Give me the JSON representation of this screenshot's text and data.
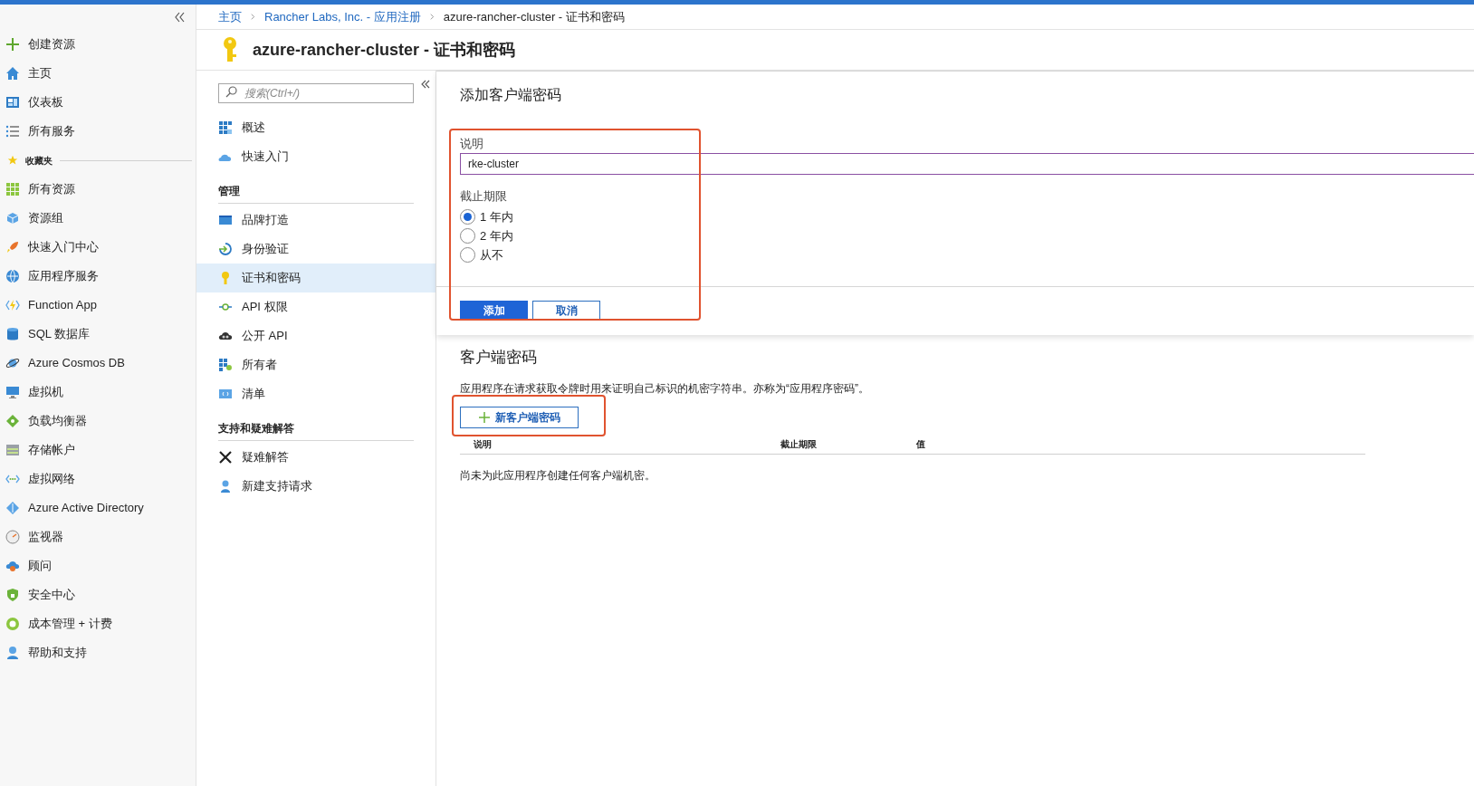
{
  "sidebar": {
    "items": [
      {
        "kind": "item",
        "label": "创建资源"
      },
      {
        "kind": "item",
        "label": "主页"
      },
      {
        "kind": "item",
        "label": "仪表板"
      },
      {
        "kind": "item",
        "label": "所有服务"
      },
      {
        "kind": "header",
        "label": "收藏夹"
      },
      {
        "kind": "item",
        "label": "所有资源"
      },
      {
        "kind": "item",
        "label": "资源组"
      },
      {
        "kind": "item",
        "label": "快速入门中心"
      },
      {
        "kind": "item",
        "label": "应用程序服务"
      },
      {
        "kind": "item",
        "label": "Function App"
      },
      {
        "kind": "item",
        "label": "SQL 数据库"
      },
      {
        "kind": "item",
        "label": "Azure Cosmos DB"
      },
      {
        "kind": "item",
        "label": "虚拟机"
      },
      {
        "kind": "item",
        "label": "负载均衡器"
      },
      {
        "kind": "item",
        "label": "存储帐户"
      },
      {
        "kind": "item",
        "label": "虚拟网络"
      },
      {
        "kind": "item",
        "label": "Azure Active Directory"
      },
      {
        "kind": "item",
        "label": "监视器"
      },
      {
        "kind": "item",
        "label": "顾问"
      },
      {
        "kind": "item",
        "label": "安全中心"
      },
      {
        "kind": "item",
        "label": "成本管理 + 计费"
      },
      {
        "kind": "item",
        "label": "帮助和支持"
      }
    ]
  },
  "breadcrumb": [
    {
      "label": "主页",
      "link": true
    },
    {
      "label": "Rancher Labs, Inc. - 应用注册",
      "link": true
    },
    {
      "label": "azure-rancher-cluster - 证书和密码",
      "link": false
    }
  ],
  "page_title": "azure-rancher-cluster - 证书和密码",
  "resource_menu": {
    "search": {
      "placeholder": "搜索(Ctrl+/)"
    },
    "items": [
      {
        "kind": "item",
        "label": "概述",
        "selected": false
      },
      {
        "kind": "item",
        "label": "快速入门",
        "selected": false
      },
      {
        "kind": "section",
        "label": "管理"
      },
      {
        "kind": "item",
        "label": "品牌打造",
        "selected": false
      },
      {
        "kind": "item",
        "label": "身份验证",
        "selected": false
      },
      {
        "kind": "item",
        "label": "证书和密码",
        "selected": true
      },
      {
        "kind": "item",
        "label": "API 权限",
        "selected": false
      },
      {
        "kind": "item",
        "label": "公开 API",
        "selected": false
      },
      {
        "kind": "item",
        "label": "所有者",
        "selected": false
      },
      {
        "kind": "item",
        "label": "清单",
        "selected": false
      },
      {
        "kind": "section",
        "label": "支持和疑难解答"
      },
      {
        "kind": "item",
        "label": "疑难解答",
        "selected": false
      },
      {
        "kind": "item",
        "label": "新建支持请求",
        "selected": false
      }
    ]
  },
  "add_secret_panel": {
    "title": "添加客户端密码",
    "description_label": "说明",
    "description_value": "rke-cluster",
    "expires_label": "截止期限",
    "expires_options": [
      {
        "label": "1 年内",
        "selected": true
      },
      {
        "label": "2 年内",
        "selected": false
      },
      {
        "label": "从不",
        "selected": false
      }
    ],
    "buttons": [
      "添加",
      "取消"
    ]
  },
  "client_secrets": {
    "title": "客户端密码",
    "description": "应用程序在请求获取令牌时用来证明自己标识的机密字符串。亦称为“应用程序密码”。",
    "new_button": "新客户端密码",
    "table": {
      "columns": [
        "说明",
        "截止期限",
        "值"
      ],
      "empty_message": "尚未为此应用程序创建任何客户端机密。"
    }
  }
}
